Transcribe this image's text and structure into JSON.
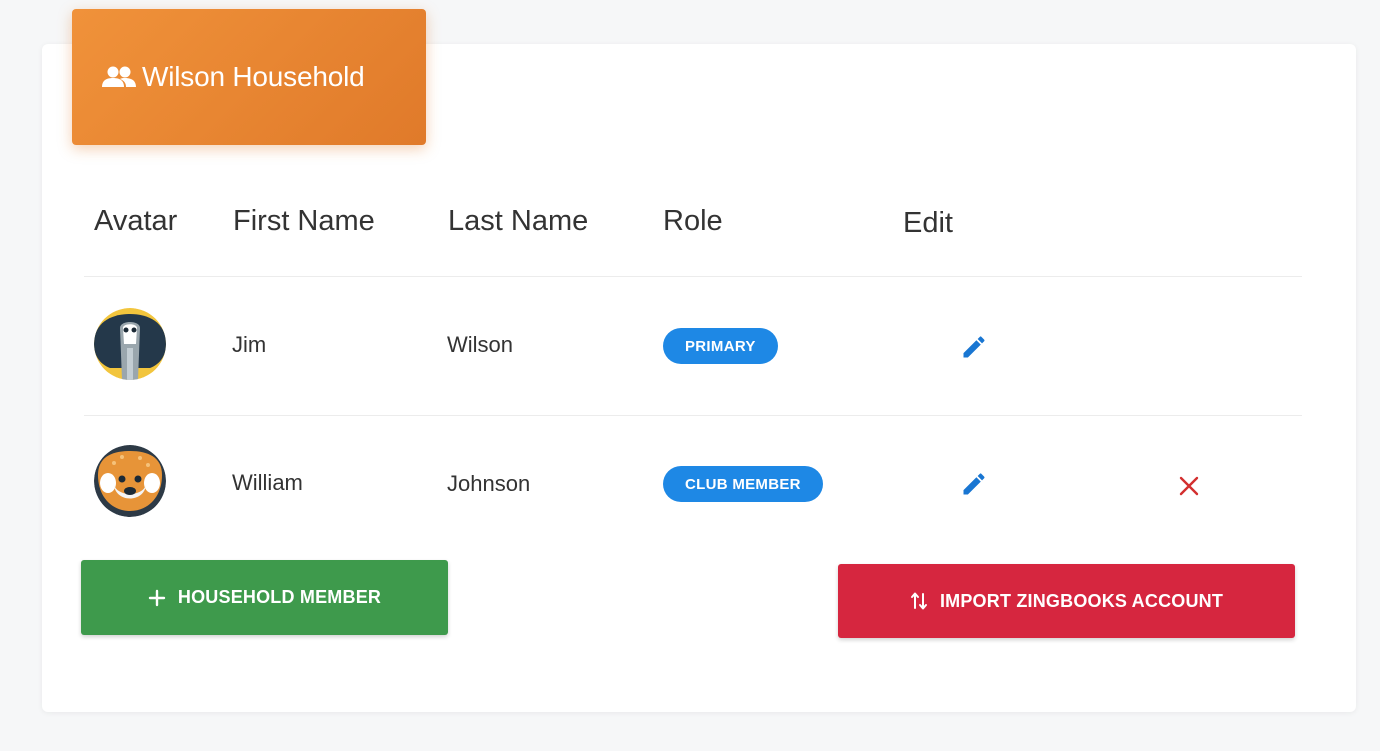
{
  "header": {
    "title": "Wilson Household",
    "icon": "household-people-icon",
    "color": "#e8842f"
  },
  "table": {
    "columns": [
      "Avatar",
      "First Name",
      "Last Name",
      "Role",
      "Edit"
    ],
    "rows": [
      {
        "first_name": "Jim",
        "last_name": "Wilson",
        "role": "PRIMARY",
        "avatar": "cobra-avatar",
        "deletable": false
      },
      {
        "first_name": "William",
        "last_name": "Johnson",
        "role": "CLUB MEMBER",
        "avatar": "fox-avatar",
        "deletable": true
      }
    ]
  },
  "actions": {
    "add_member_label": "HOUSEHOLD MEMBER",
    "import_label": "IMPORT ZINGBOOKS ACCOUNT"
  },
  "colors": {
    "badge": "#1e88e5",
    "edit_icon": "#1976d2",
    "delete_icon": "#d32f2f",
    "add_button": "#3e9a4c",
    "import_button": "#d6263f"
  }
}
